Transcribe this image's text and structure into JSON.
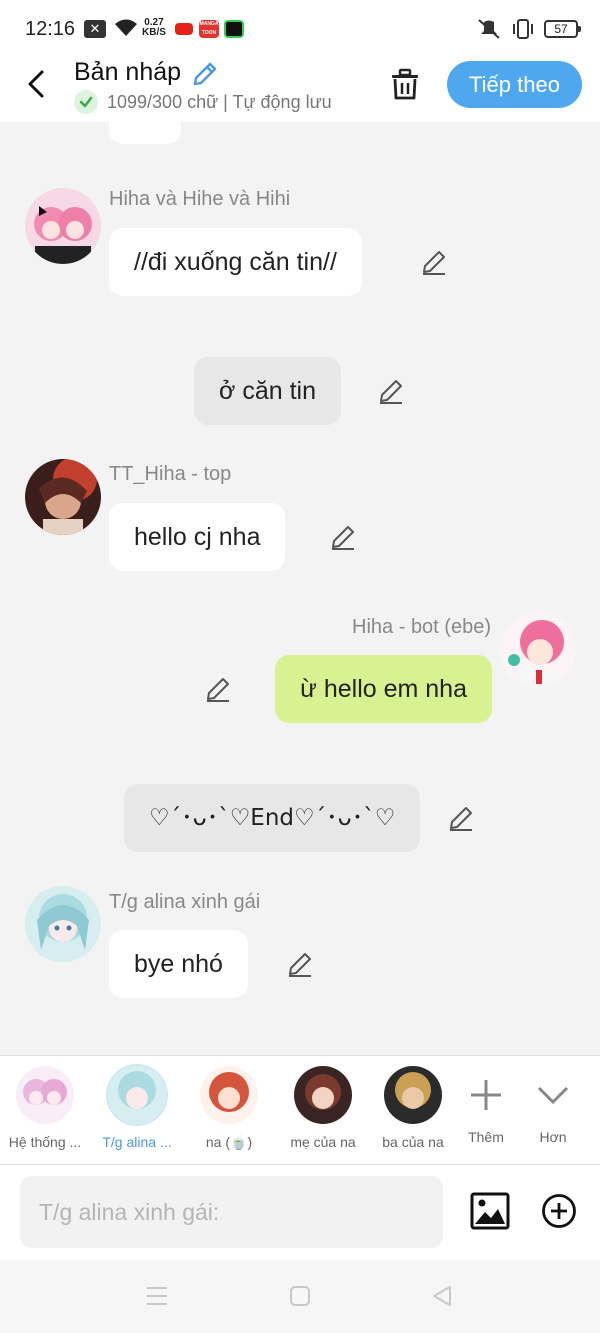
{
  "status_bar": {
    "time": "12:16",
    "net_speed_value": "0.27",
    "net_speed_unit": "KB/S",
    "battery": "57",
    "manga_label": "MANGA TOON"
  },
  "header": {
    "title": "Bản nháp",
    "subtitle": "1099/300 chữ | Tự động lưu",
    "next_label": "Tiếp theo"
  },
  "messages": [
    {
      "sender": "Hiha và Hihe và Hihi",
      "text": "//đi xuống căn tin//"
    },
    {
      "sender": "",
      "text": "ở căn tin"
    },
    {
      "sender": "TT_Hiha - top",
      "text": "hello cj nha"
    },
    {
      "sender": "Hiha - bot (ebe)",
      "text": "ừ hello em nha"
    },
    {
      "sender": "",
      "text": "♡´･ᴗ･`♡End♡´･ᴗ･`♡"
    },
    {
      "sender": "T/g alina xinh gái",
      "text": "bye nhó"
    }
  ],
  "characters": [
    {
      "name": "Hệ thống ..."
    },
    {
      "name": "T/g alina ..."
    },
    {
      "name": "na (🍵)"
    },
    {
      "name": "mẹ của na"
    },
    {
      "name": "ba của na"
    }
  ],
  "char_actions": {
    "add_label": "Thêm",
    "more_label": "Hơn"
  },
  "input": {
    "placeholder": "T/g alina xinh gái:"
  },
  "colors": {
    "accent": "#4fa8ef",
    "self_bubble": "#d9f291",
    "narration_bubble": "#e7e7e7"
  }
}
